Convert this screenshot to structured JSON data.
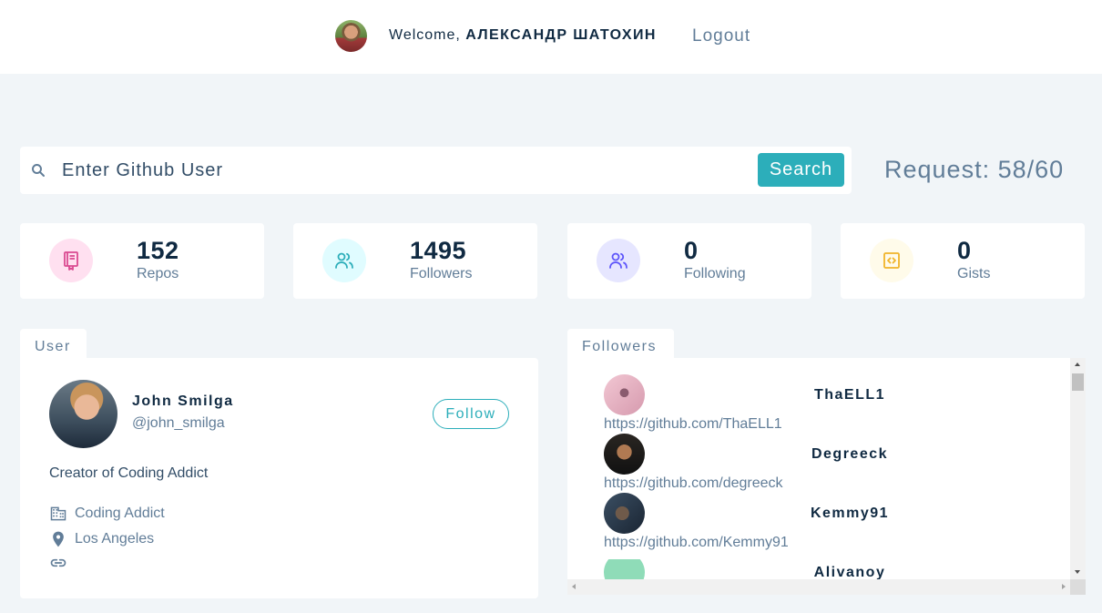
{
  "navbar": {
    "welcome_prefix": "Welcome, ",
    "user_name": "АЛЕКСАНДР ШАТОХИН",
    "logout_label": "Logout"
  },
  "search": {
    "placeholder": "Enter Github User",
    "value": "",
    "button_label": "Search",
    "requests_label": "Request: 58/60"
  },
  "stats": [
    {
      "value": "152",
      "label": "Repos",
      "icon": "book-icon",
      "icon_color": "#da4a91",
      "icon_bg": "#ffe0f0"
    },
    {
      "value": "1495",
      "label": "Followers",
      "icon": "users-icon",
      "icon_color": "#2caeba",
      "icon_bg": "#e0fcff"
    },
    {
      "value": "0",
      "label": "Following",
      "icon": "user-plus-icon",
      "icon_color": "#5d55fa",
      "icon_bg": "#e6e6ff"
    },
    {
      "value": "0",
      "label": "Gists",
      "icon": "code-icon",
      "icon_color": "#f0b429",
      "icon_bg": "#fffbea"
    }
  ],
  "user_section": {
    "tab_label": "User",
    "name": "John Smilga",
    "handle": "@john_smilga",
    "follow_label": "Follow",
    "bio": "Creator of Coding Addict",
    "company": "Coding Addict",
    "location": "Los Angeles",
    "blog": ""
  },
  "followers_section": {
    "tab_label": "Followers",
    "items": [
      {
        "name": "ThaELL1",
        "url": "https://github.com/ThaELL1"
      },
      {
        "name": "Degreeck",
        "url": "https://github.com/degreeck"
      },
      {
        "name": "Kemmy91",
        "url": "https://github.com/Kemmy91"
      },
      {
        "name": "Alivanoy",
        "url": ""
      }
    ]
  },
  "colors": {
    "primary": "#2caeba",
    "background": "#f1f5f8",
    "text_dark": "#102a42",
    "text_muted": "#617d98"
  }
}
